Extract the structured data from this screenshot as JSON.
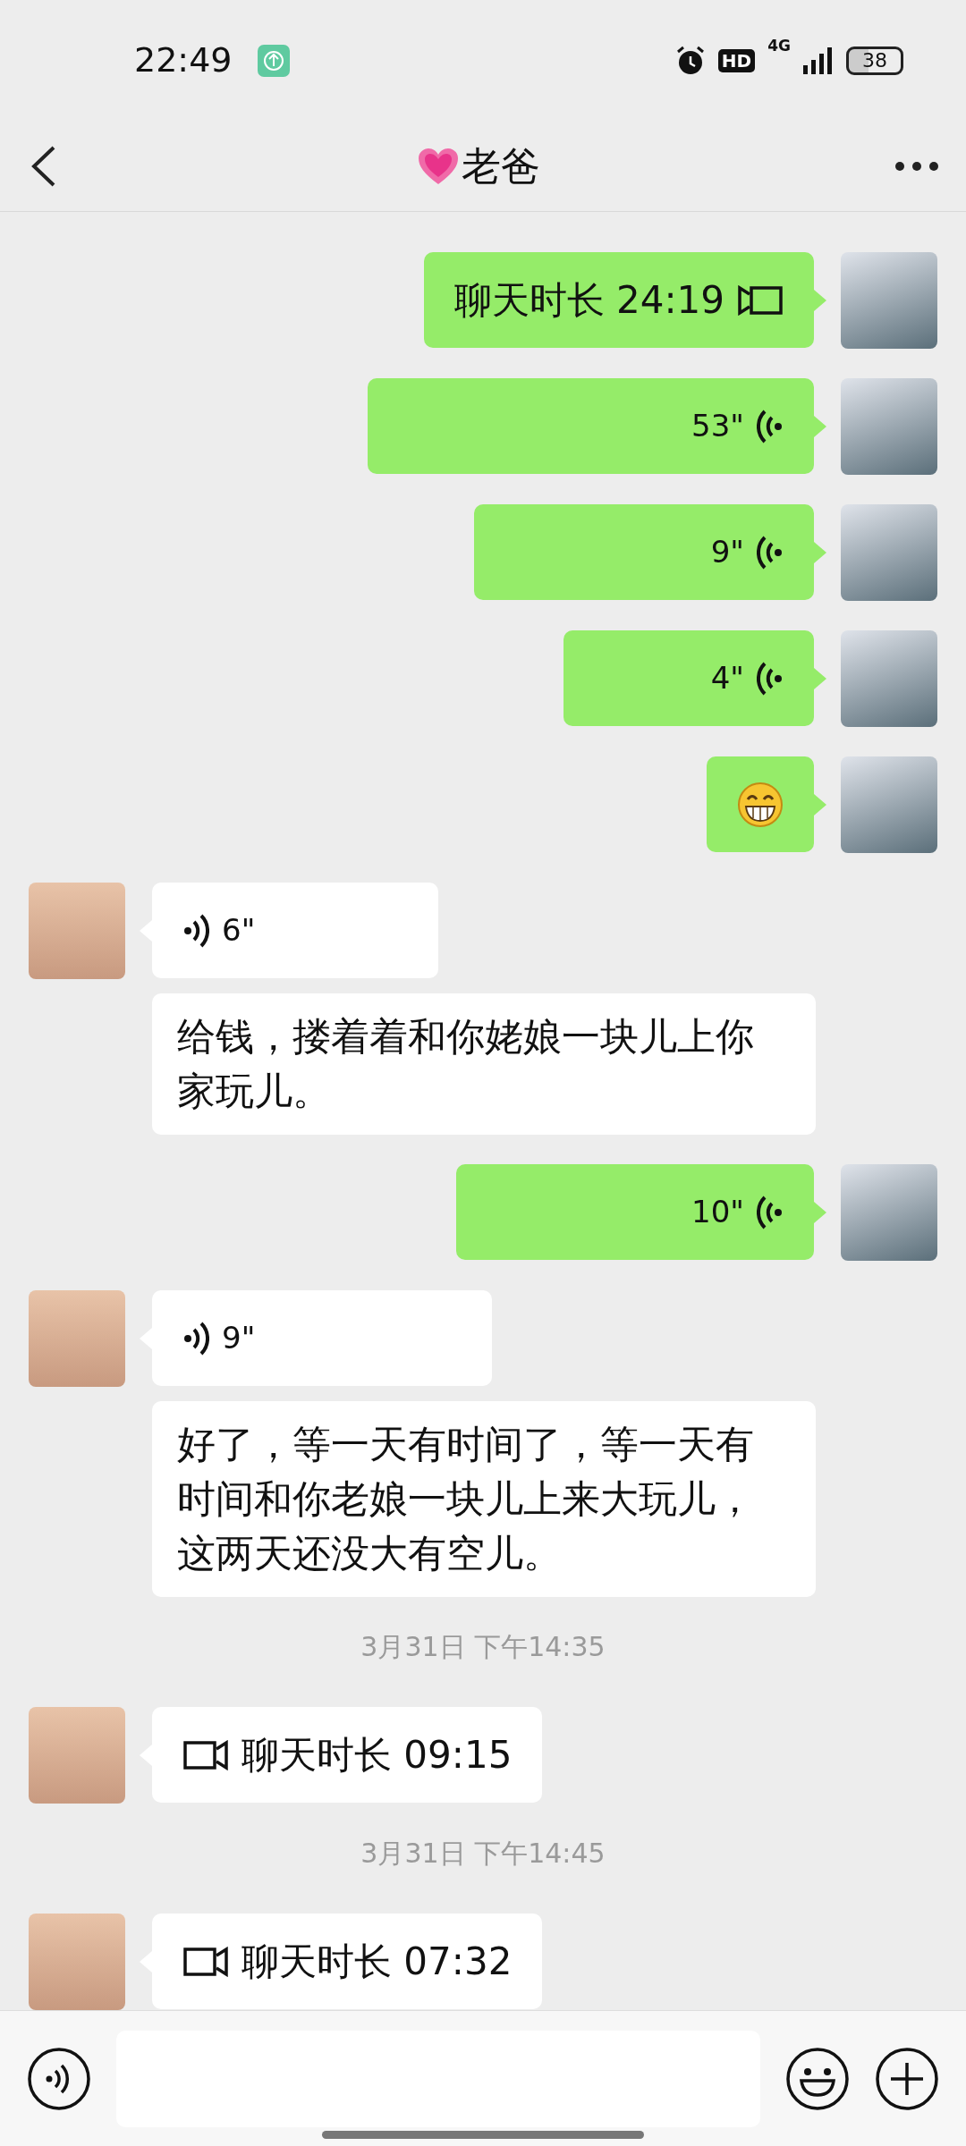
{
  "status_bar": {
    "time": "22:49",
    "hd": "HD",
    "network": "4G",
    "battery": "38"
  },
  "header": {
    "title": "老爸"
  },
  "messages": [
    {
      "kind": "video_call",
      "outgoing": true,
      "text": "聊天时长 24:19"
    },
    {
      "kind": "voice",
      "outgoing": true,
      "duration": "53\""
    },
    {
      "kind": "voice",
      "outgoing": true,
      "duration": "9\""
    },
    {
      "kind": "voice",
      "outgoing": true,
      "duration": "4\""
    },
    {
      "kind": "sticker",
      "outgoing": true
    },
    {
      "kind": "voice",
      "outgoing": false,
      "duration": "6\"",
      "transcription": "给钱，搂着着和你姥娘一块儿上你家玩儿。"
    },
    {
      "kind": "voice",
      "outgoing": true,
      "duration": "10\""
    },
    {
      "kind": "voice",
      "outgoing": false,
      "duration": "9\"",
      "transcription": "好了，等一天有时间了，等一天有时间和你老娘一块儿上来大玩儿，这两天还没大有空儿。"
    },
    {
      "kind": "timestamp",
      "text": "3月31日 下午14:35"
    },
    {
      "kind": "video_call",
      "outgoing": false,
      "text": "聊天时长 09:15"
    },
    {
      "kind": "timestamp",
      "text": "3月31日 下午14:45"
    },
    {
      "kind": "video_call",
      "outgoing": false,
      "text": "聊天时长 07:32"
    }
  ]
}
